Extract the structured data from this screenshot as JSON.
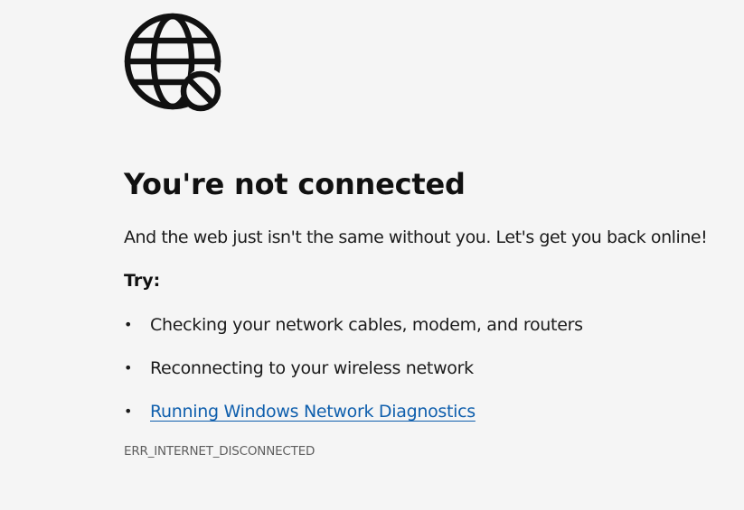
{
  "icon": "globe-blocked-icon",
  "colors": {
    "background": "#f5f5f5",
    "text": "#1b1b1b",
    "link": "#0f5fad",
    "error_code": "#5f5f5f"
  },
  "title": "You're not connected",
  "subtitle": "And the web just isn't the same without you. Let's get you back online!",
  "try_label": "Try:",
  "suggestions": [
    {
      "text": "Checking your network cables, modem, and routers",
      "link": false
    },
    {
      "text": "Reconnecting to your wireless network",
      "link": false
    },
    {
      "text": "Running Windows Network Diagnostics",
      "link": true
    }
  ],
  "error_code": "ERR_INTERNET_DISCONNECTED"
}
